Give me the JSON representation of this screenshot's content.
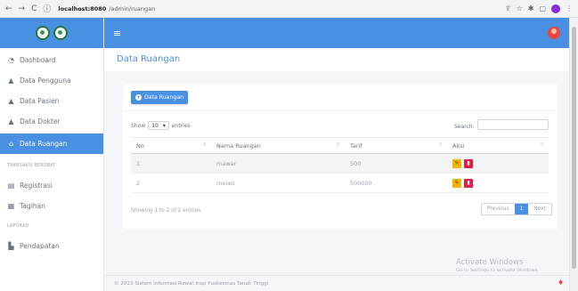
{
  "browser": {
    "nav": [
      "←",
      "→",
      "C",
      "ⓘ"
    ],
    "host": "localhost:8080",
    "path": "/admin/ruangan",
    "right_icons": [
      "share-icon",
      "star-icon",
      "extensions-icon",
      "window-icon",
      "profile-icon",
      "menu-icon"
    ]
  },
  "sidebar": {
    "items": [
      {
        "label": "Dashboard",
        "icon": "dashboard-icon"
      },
      {
        "label": "Data Pengguna",
        "icon": "user-icon"
      },
      {
        "label": "Data Pasien",
        "icon": "user-icon"
      },
      {
        "label": "Data Dokter",
        "icon": "user-icon"
      },
      {
        "label": "Data Ruangan",
        "icon": "home-icon",
        "active": true
      },
      {
        "heading": "TRANSAKSI BEROBAT"
      },
      {
        "label": "Registrasi",
        "icon": "register-icon"
      },
      {
        "label": "Tagihan",
        "icon": "invoice-icon"
      },
      {
        "heading": "LAPORAN"
      },
      {
        "label": "Pendapatan",
        "icon": "chart-icon"
      }
    ]
  },
  "topbar": {
    "menu_icon": "hamburger-icon",
    "avatar_icon": "user-avatar-icon"
  },
  "page": {
    "title": "Data Ruangan"
  },
  "card": {
    "add_button": "Data Ruangan",
    "show_label": "Show",
    "entries_value": "10",
    "entries_label": "entries",
    "search_label": "Search:",
    "search_value": "",
    "columns": [
      "No",
      "Nama Ruangan",
      "Tarif",
      "Aksi"
    ],
    "rows": [
      {
        "no": "1",
        "nama": "mawar",
        "tarif": "500"
      },
      {
        "no": "2",
        "nama": "melati",
        "tarif": "500000"
      }
    ],
    "info": "Showing 1 to 2 of 2 entries",
    "pager": {
      "prev": "Previous",
      "current": "1",
      "next": "Next"
    }
  },
  "footer": {
    "text": "© 2023 Sistem Informasi Rawat Inap Puskesmas Tanah Tinggi"
  },
  "watermark": {
    "line1": "Activate Windows",
    "line2": "Go to Settings to activate Windows."
  },
  "colors": {
    "primary": "#4a90e2",
    "edit": "#f5b400",
    "delete": "#e11d48"
  }
}
